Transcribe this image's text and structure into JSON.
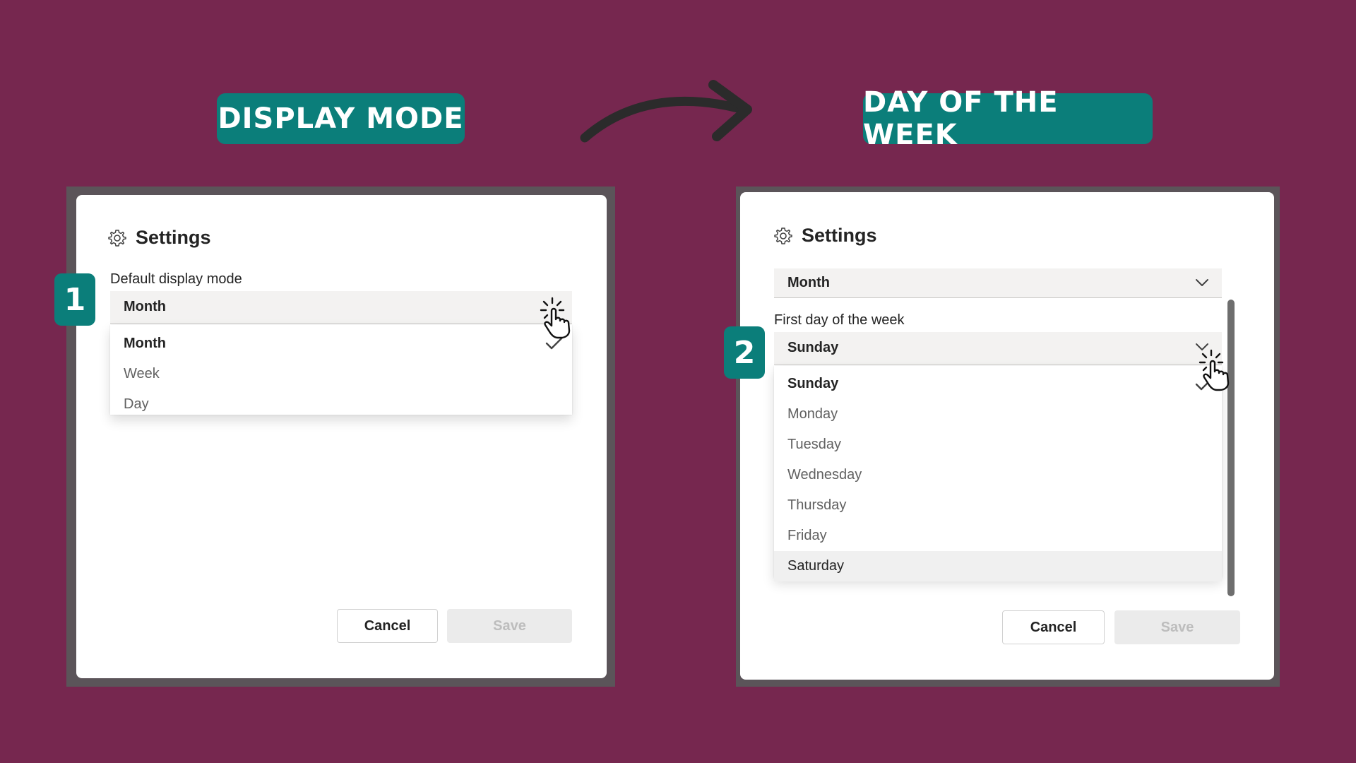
{
  "left": {
    "heading": "DISPLAY MODE",
    "step": "1",
    "dialog": {
      "title": "Settings",
      "field_label": "Default display mode",
      "selected_value": "Month",
      "options": [
        "Month",
        "Week",
        "Day"
      ],
      "cancel_label": "Cancel",
      "save_label": "Save"
    }
  },
  "right": {
    "heading": "DAY OF THE WEEK",
    "step": "2",
    "dialog": {
      "title": "Settings",
      "display_mode_value": "Month",
      "field_label": "First day of the week",
      "selected_value": "Sunday",
      "options": [
        "Sunday",
        "Monday",
        "Tuesday",
        "Wednesday",
        "Thursday",
        "Friday",
        "Saturday"
      ],
      "cancel_label": "Cancel",
      "save_label": "Save"
    }
  },
  "icons": [
    "gear-icon",
    "chevron-down-icon",
    "checkmark-icon",
    "hand-pointer-icon",
    "curved-arrow-icon"
  ],
  "colors": {
    "background": "#76274f",
    "accent": "#0b7e7a",
    "frame": "#5b5459"
  }
}
